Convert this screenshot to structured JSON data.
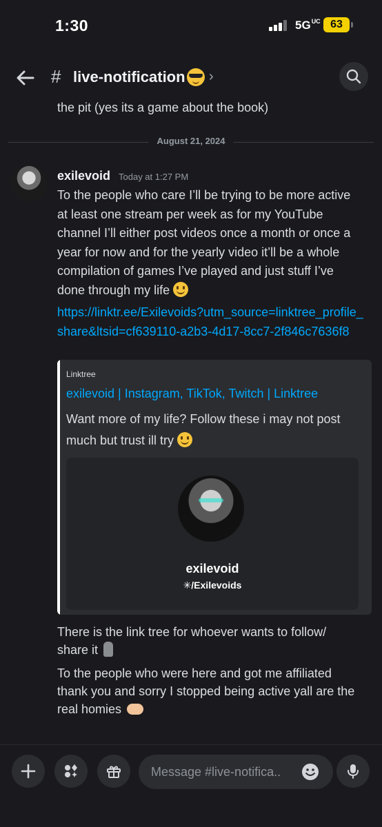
{
  "status_bar": {
    "time": "1:30",
    "network": "5G",
    "network_suffix": "UC",
    "battery": "63"
  },
  "header": {
    "hash": "#",
    "channel_name": "live-notification",
    "chevron": "›"
  },
  "messages": {
    "previous_line": "the pit (yes its a game about the book)",
    "date_divider": "August 21, 2024",
    "author": "exilevoid",
    "timestamp": "Today at 1:27 PM",
    "body": "To the people who care I’ll be trying to be more active at least one stream per week as for my YouTube channel I’ll either post videos once a month or once a year for now and for the yearly video it’ll be a whole compilation of games I’ve played and just stuff I’ve done through my life",
    "link": "https://linktr.ee/Exilevoids?utm_source=linktree_profile_share&ltsid=cf639110-a2b3-4d17-8cc7-2f846c7636f8",
    "followup_1": "There is the link tree for whoever wants to follow/ share it",
    "followup_2": "To the people who were here and got me affiliated thank you and sorry I stopped being active yall are the real homies"
  },
  "embed": {
    "provider": "Linktree",
    "title": "exilevoid | Instagram, TikTok, Twitch | Linktree",
    "description": "Want more of my life? Follow these i may not post much but trust ill try",
    "card_name": "exilevoid",
    "card_handle": "✳/Exilevoids"
  },
  "composer": {
    "placeholder": "Message #live-notifica.."
  },
  "colors": {
    "background": "#1a1a1e",
    "link": "#00a8fc",
    "battery": "#f4d100"
  },
  "icons": [
    "back-arrow-icon",
    "search-icon",
    "plus-icon",
    "apps-icon",
    "gift-icon",
    "emoji-icon",
    "microphone-icon"
  ]
}
